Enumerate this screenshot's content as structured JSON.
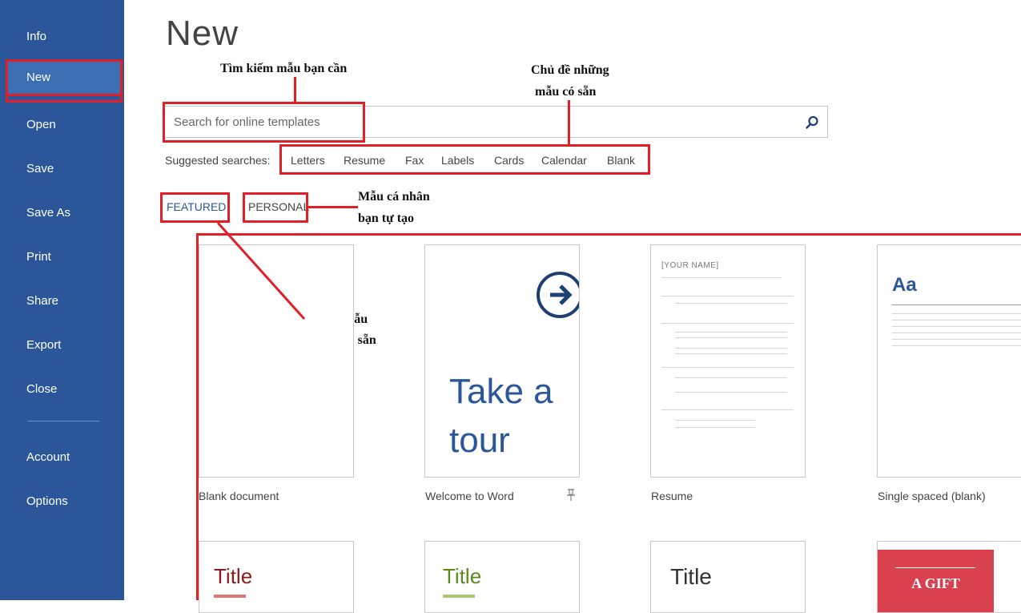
{
  "sidebar": {
    "items": [
      "Info",
      "New",
      "Open",
      "Save",
      "Save As",
      "Print",
      "Share",
      "Export",
      "Close"
    ],
    "bottom": [
      "Account",
      "Options"
    ],
    "bg_color": "#2b579a",
    "active_color": "#3c6eb4"
  },
  "page": {
    "title": "New"
  },
  "search": {
    "placeholder": "Search for online templates",
    "icon": "search-icon"
  },
  "suggested": {
    "label": "Suggested searches:",
    "items": [
      "Letters",
      "Resume",
      "Fax",
      "Labels",
      "Cards",
      "Calendar",
      "Blank"
    ]
  },
  "tabs": {
    "featured": "FEATURED",
    "personal": "PERSONAL"
  },
  "annotations": {
    "search": "Tìm kiếm mẫu bạn cần",
    "topics_1": "Chủ đề những",
    "topics_2": "mẫu có sẵn",
    "personal_1": "Mẫu cá nhân",
    "personal_2": "bạn tự tạo",
    "featured_1": "Những mẫu",
    "featured_2": "nổi bật có sẵn",
    "highlight_color": "#e21f26"
  },
  "templates": [
    {
      "label": "Blank document"
    },
    {
      "label": "Welcome to Word",
      "tour_line1": "Take a",
      "tour_line2": "tour",
      "pin_icon": "pin-icon"
    },
    {
      "label": "Resume",
      "name": "[YOUR NAME]"
    },
    {
      "label": "Single spaced (blank)",
      "sample": "Aa"
    }
  ],
  "templates_row2": [
    {
      "title": "Title",
      "color": "#8b1a1a"
    },
    {
      "title": "Title",
      "color": "#5b8a1e"
    },
    {
      "title": "Title",
      "color": "#333333"
    },
    {
      "badge": "A GIFT",
      "color": "#d9414e"
    }
  ]
}
